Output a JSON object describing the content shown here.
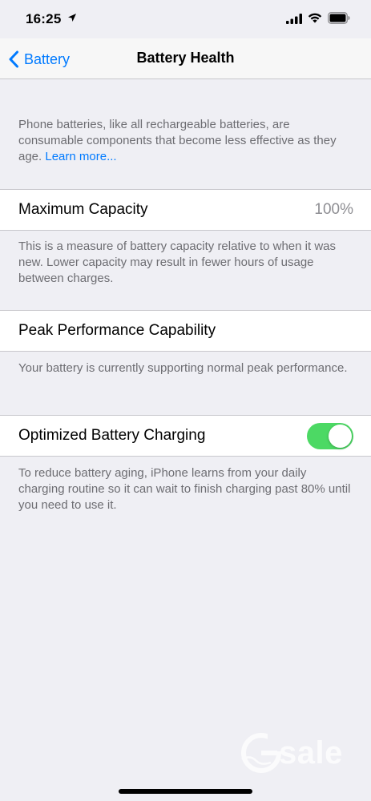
{
  "status_bar": {
    "time": "16:25",
    "icons": [
      "location-arrow-icon",
      "cellular-signal-icon",
      "wifi-icon",
      "battery-icon"
    ]
  },
  "nav": {
    "back_label": "Battery",
    "title": "Battery Health"
  },
  "intro": {
    "text": "Phone batteries, like all rechargeable batteries, are consumable components that become less effective as they age.",
    "link": "Learn more..."
  },
  "max_capacity": {
    "label": "Maximum Capacity",
    "value": "100%",
    "description": "This is a measure of battery capacity relative to when it was new. Lower capacity may result in fewer hours of usage between charges."
  },
  "peak_performance": {
    "label": "Peak Performance Capability",
    "description": "Your battery is currently supporting normal peak performance."
  },
  "optimized_charging": {
    "label": "Optimized Battery Charging",
    "enabled": true,
    "description": "To reduce battery aging, iPhone learns from your daily charging routine so it can wait to finish charging past 80% until you need to use it."
  },
  "watermark": {
    "text": "sale"
  },
  "colors": {
    "accent": "#007aff",
    "toggle_on": "#4cd964",
    "background": "#efeff4",
    "secondary_text": "#6d6d72",
    "value_text": "#8e8e93"
  }
}
